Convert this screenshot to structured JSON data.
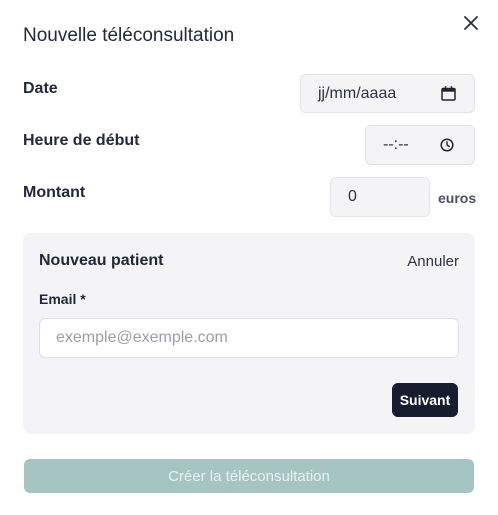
{
  "dialog": {
    "title": "Nouvelle téléconsultation",
    "close_icon": "close-icon"
  },
  "form": {
    "date": {
      "label": "Date",
      "placeholder": "jj/mm/aaaa",
      "icon": "calendar-icon"
    },
    "start_time": {
      "label": "Heure de début",
      "placeholder": "--:--",
      "icon": "clock-icon"
    },
    "amount": {
      "label": "Montant",
      "value": "0",
      "unit": "euros"
    }
  },
  "patient": {
    "title": "Nouveau patient",
    "cancel_label": "Annuler",
    "email_label": "Email *",
    "email_placeholder": "exemple@exemple.com",
    "next_label": "Suivant"
  },
  "actions": {
    "create_label": "Créer la téléconsultation"
  },
  "colors": {
    "primary_dark": "#171c2e",
    "create_button_disabled": "#a6c5c2",
    "panel_background": "#f4f4f6"
  }
}
